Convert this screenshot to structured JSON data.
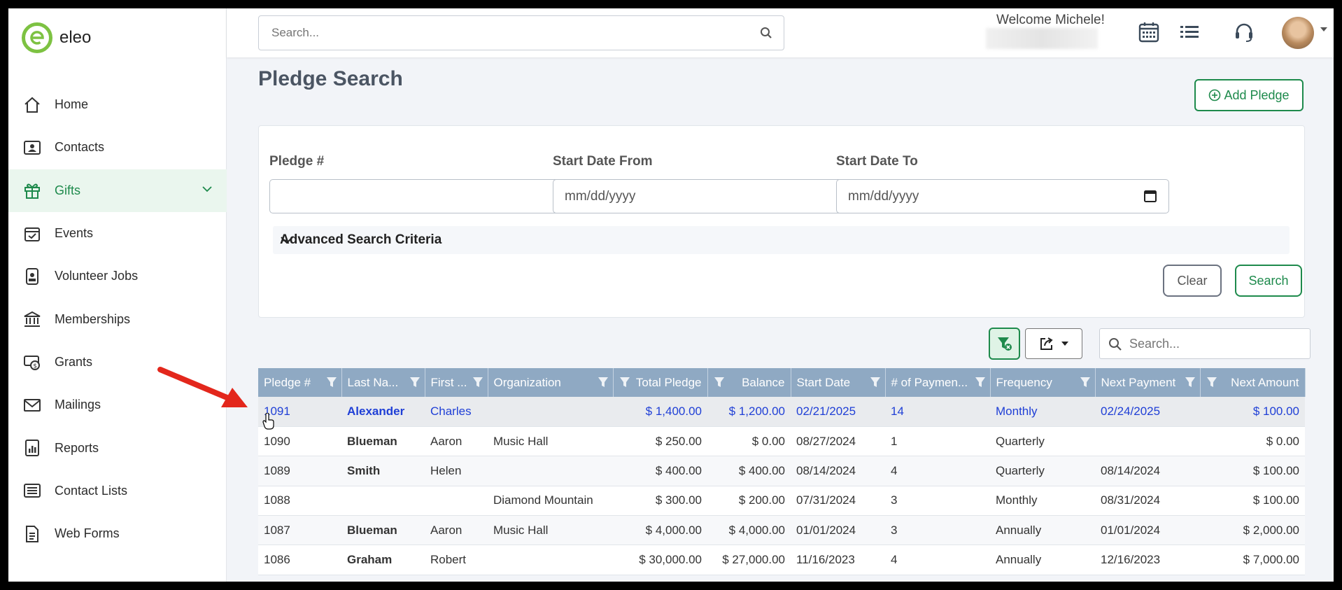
{
  "app": {
    "name": "eleo"
  },
  "sidebar": {
    "items": [
      {
        "label": "Home",
        "icon": "home-icon"
      },
      {
        "label": "Contacts",
        "icon": "contact-card-icon"
      },
      {
        "label": "Gifts",
        "icon": "gift-icon",
        "active": true
      },
      {
        "label": "Events",
        "icon": "calendar-check-icon"
      },
      {
        "label": "Volunteer Jobs",
        "icon": "badge-icon"
      },
      {
        "label": "Memberships",
        "icon": "bank-icon"
      },
      {
        "label": "Grants",
        "icon": "money-icon"
      },
      {
        "label": "Mailings",
        "icon": "envelope-icon"
      },
      {
        "label": "Reports",
        "icon": "report-icon"
      },
      {
        "label": "Contact Lists",
        "icon": "list-icon"
      },
      {
        "label": "Web Forms",
        "icon": "document-icon"
      }
    ]
  },
  "topbar": {
    "search_placeholder": "Search...",
    "welcome": "Welcome Michele!"
  },
  "page": {
    "title": "Pledge Search",
    "add_button": "Add Pledge"
  },
  "search_form": {
    "pledge_label": "Pledge #",
    "start_from_label": "Start Date From",
    "start_to_label": "Start Date To",
    "date_placeholder": "mm/dd/yyyy",
    "advanced_label": "Advanced Search Criteria",
    "clear_button": "Clear",
    "search_button": "Search"
  },
  "grid": {
    "search_placeholder": "Search...",
    "columns": [
      "Pledge #",
      "Last Na...",
      "First ...",
      "Organization",
      "Total Pledge",
      "Balance",
      "Start Date",
      "# of Paymen...",
      "Frequency",
      "Next Payment",
      "Next Amount"
    ],
    "rows": [
      [
        "1091",
        "Alexander",
        "Charles",
        "",
        "$ 1,400.00",
        "$ 1,200.00",
        "02/21/2025",
        "14",
        "Monthly",
        "02/24/2025",
        "$ 100.00"
      ],
      [
        "1090",
        "Blueman",
        "Aaron",
        "Music Hall",
        "$ 250.00",
        "$ 0.00",
        "08/27/2024",
        "1",
        "Quarterly",
        "",
        "$ 0.00"
      ],
      [
        "1089",
        "Smith",
        "Helen",
        "",
        "$ 400.00",
        "$ 400.00",
        "08/14/2024",
        "4",
        "Quarterly",
        "08/14/2024",
        "$ 100.00"
      ],
      [
        "1088",
        "",
        "",
        "Diamond Mountain",
        "$ 300.00",
        "$ 200.00",
        "07/31/2024",
        "3",
        "Monthly",
        "08/31/2024",
        "$ 100.00"
      ],
      [
        "1087",
        "Blueman",
        "Aaron",
        "Music Hall",
        "$ 4,000.00",
        "$ 4,000.00",
        "01/01/2024",
        "3",
        "Annually",
        "01/01/2024",
        "$ 2,000.00"
      ],
      [
        "1086",
        "Graham",
        "Robert",
        "",
        "$ 30,000.00",
        "$ 27,000.00",
        "11/16/2023",
        "4",
        "Annually",
        "12/16/2023",
        "$ 7,000.00"
      ]
    ]
  },
  "colors": {
    "brand_green": "#1e8a4c",
    "logo_green": "#7dc242",
    "header_blue": "#8fa9c3",
    "annotation_arrow": "#e3271c"
  }
}
